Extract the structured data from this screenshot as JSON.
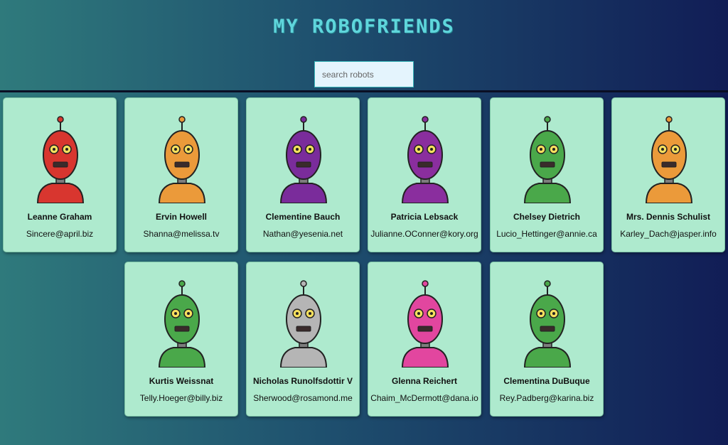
{
  "app": {
    "title": "My RoboFriends"
  },
  "search": {
    "placeholder": "search robots",
    "value": ""
  },
  "robots": [
    {
      "name": "Leanne Graham",
      "email": "Sincere@april.biz",
      "color": "#d8362f"
    },
    {
      "name": "Ervin Howell",
      "email": "Shanna@melissa.tv",
      "color": "#eb9a3a"
    },
    {
      "name": "Clementine Bauch",
      "email": "Nathan@yesenia.net",
      "color": "#7a2c9b"
    },
    {
      "name": "Patricia Lebsack",
      "email": "Julianne.OConner@kory.org",
      "color": "#8a2e9e"
    },
    {
      "name": "Chelsey Dietrich",
      "email": "Lucio_Hettinger@annie.ca",
      "color": "#4aa84a"
    },
    {
      "name": "Mrs. Dennis Schulist",
      "email": "Karley_Dach@jasper.info",
      "color": "#eb9a3a"
    },
    {
      "name": "Kurtis Weissnat",
      "email": "Telly.Hoeger@billy.biz",
      "color": "#4aa84a"
    },
    {
      "name": "Nicholas Runolfsdottir V",
      "email": "Sherwood@rosamond.me",
      "color": "#b5b5b5"
    },
    {
      "name": "Glenna Reichert",
      "email": "Chaim_McDermott@dana.io",
      "color": "#e2469f"
    },
    {
      "name": "Clementina DuBuque",
      "email": "Rey.Padberg@karina.biz",
      "color": "#4aa84a"
    }
  ]
}
